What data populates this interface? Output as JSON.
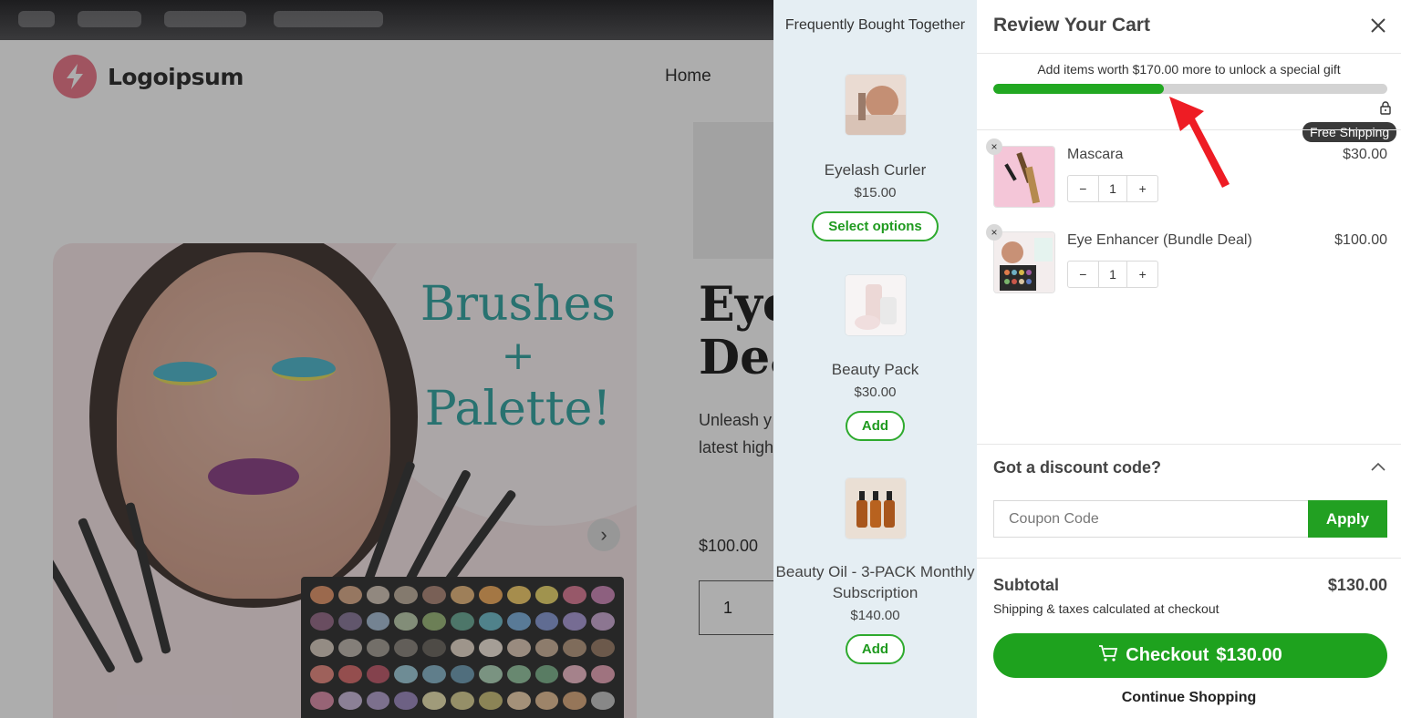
{
  "store": {
    "logo_text": "Logoipsum",
    "nav_home": "Home",
    "banner": {
      "line1": "Brushes",
      "line2": "+",
      "line3": "Palette!"
    },
    "product_title": "Eye\nDea",
    "product_desc": "Unleash y best-sellir latest high game!",
    "product_price": "$100.00",
    "qty": "1"
  },
  "upsell": {
    "title": "Frequently Bought Together",
    "items": [
      {
        "name": "Eyelash Curler",
        "price": "$15.00",
        "button": "Select options"
      },
      {
        "name": "Beauty Pack",
        "price": "$30.00",
        "button": "Add"
      },
      {
        "name": "Beauty Oil - 3-PACK Monthly Subscription",
        "price": "$140.00",
        "button": "Add"
      }
    ]
  },
  "cart": {
    "title": "Review Your Cart",
    "progress_message": "Add items worth $170.00 more to unlock a special gift",
    "progress_fraction": 0.433,
    "milestone_label": "Free Shipping",
    "items": [
      {
        "name": "Mascara",
        "price": "$30.00",
        "qty": "1"
      },
      {
        "name": "Eye Enhancer (Bundle Deal)",
        "price": "$100.00",
        "qty": "1"
      }
    ],
    "stepper_minus": "−",
    "stepper_plus": "+",
    "remove_glyph": "×",
    "discount_heading": "Got a discount code?",
    "coupon_placeholder": "Coupon Code",
    "apply_label": "Apply",
    "subtotal_label": "Subtotal",
    "subtotal_value": "$130.00",
    "shipping_note": "Shipping & taxes calculated at checkout",
    "checkout_label": "Checkout",
    "checkout_amount": "$130.00",
    "continue_label": "Continue Shopping"
  },
  "colors": {
    "accent_green": "#1ea21e",
    "annotation_red": "#ee1c24",
    "upsell_bg": "#e5eef3"
  }
}
